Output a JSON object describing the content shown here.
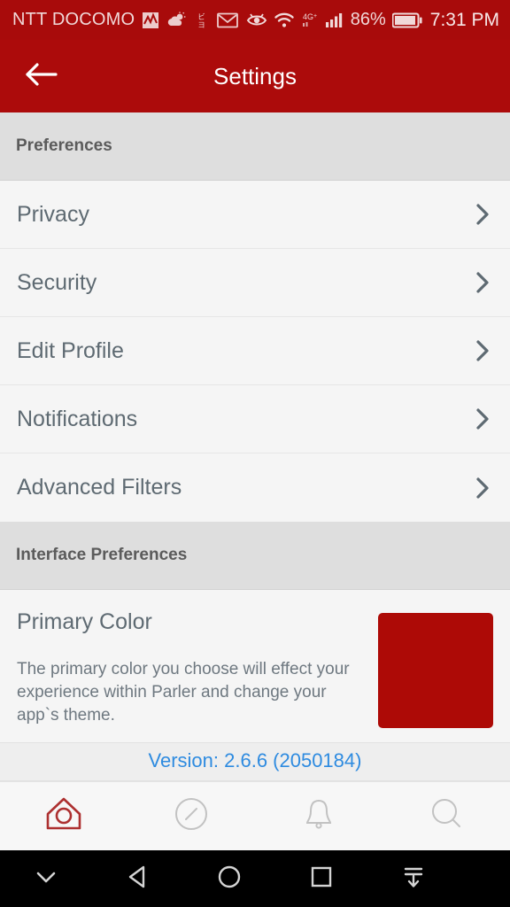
{
  "status_bar": {
    "carrier": "NTT DOCOMO",
    "left_icons": [
      "signal-chart-icon",
      "weather-cloud-icon",
      "japanese-app-icon",
      "mail-icon"
    ],
    "right_icons": [
      "eye-icon",
      "wifi-icon",
      "network-4g-icon",
      "cellular-signal-icon"
    ],
    "network_label": "4G",
    "battery_percent": "86%",
    "battery_icon": "battery-icon",
    "clock": "7:31 PM"
  },
  "app_bar": {
    "back_icon": "arrow-left-icon",
    "title": "Settings"
  },
  "sections": [
    {
      "header": "Preferences",
      "items": [
        {
          "label": "Privacy",
          "chevron": "chevron-right-icon"
        },
        {
          "label": "Security",
          "chevron": "chevron-right-icon"
        },
        {
          "label": "Edit Profile",
          "chevron": "chevron-right-icon"
        },
        {
          "label": "Notifications",
          "chevron": "chevron-right-icon"
        },
        {
          "label": "Advanced Filters",
          "chevron": "chevron-right-icon"
        }
      ]
    },
    {
      "header": "Interface Preferences"
    }
  ],
  "primary_color": {
    "title": "Primary Color",
    "description": "The primary color you choose will effect your experience within Parler and change your app`s theme.",
    "swatch_color": "#ad0a06"
  },
  "version": {
    "text": "Version: 2.6.6 (2050184)",
    "color": "#2e8be0"
  },
  "tab_bar": {
    "tabs": [
      {
        "name": "home-icon",
        "active": true
      },
      {
        "name": "compass-icon",
        "active": false
      },
      {
        "name": "bell-icon",
        "active": false
      },
      {
        "name": "search-icon",
        "active": false
      }
    ],
    "active_color": "#ad3030",
    "inactive_color": "#bdbdbd"
  },
  "android_nav": {
    "buttons": [
      "chevron-down-icon",
      "back-triangle-icon",
      "home-circle-icon",
      "recents-square-icon",
      "hide-keyboard-icon"
    ]
  },
  "theme": {
    "app_bar_red": "#ac0b0b",
    "status_bar_red": "#a80b0b",
    "section_header_bg": "#dedede",
    "list_bg": "#f5f5f5",
    "label_color": "#5e6a72"
  }
}
